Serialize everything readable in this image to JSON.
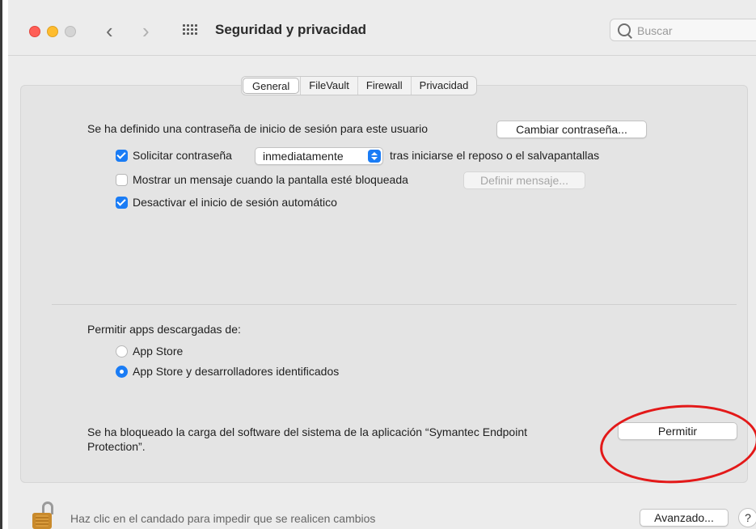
{
  "window": {
    "title": "Seguridad y privacidad",
    "search_placeholder": "Buscar"
  },
  "tabs": [
    {
      "label": "General",
      "selected": true
    },
    {
      "label": "FileVault",
      "selected": false
    },
    {
      "label": "Firewall",
      "selected": false
    },
    {
      "label": "Privacidad",
      "selected": false
    }
  ],
  "general": {
    "password_set_text": "Se ha definido una contraseña de inicio de sesión para este usuario",
    "change_password_button": "Cambiar contraseña...",
    "require_password": {
      "label": "Solicitar contraseña",
      "checked": true
    },
    "require_password_select": "inmediatamente",
    "require_password_suffix": "tras iniciarse el reposo o el salvapantallas",
    "show_message": {
      "label": "Mostrar un mensaje cuando la pantalla esté bloqueada",
      "checked": false
    },
    "set_message_button": "Definir mensaje...",
    "disable_autologin": {
      "label": "Desactivar el inicio de sesión automático",
      "checked": true
    }
  },
  "downloads": {
    "heading": "Permitir apps descargadas de:",
    "options": [
      {
        "label": "App Store",
        "selected": false
      },
      {
        "label": "App Store y desarrolladores identificados",
        "selected": true
      }
    ]
  },
  "blocked": {
    "line1": "Se ha bloqueado la carga del software del sistema de la aplicación “Symantec Endpoint",
    "line2": "Protection”.",
    "allow_button": "Permitir"
  },
  "footer": {
    "lock_text": "Haz clic en el candado para impedir que se realicen cambios",
    "advanced_button": "Avanzado...",
    "help_button": "?"
  },
  "colors": {
    "accent": "#1a7cf5",
    "annotation": "#e31919"
  }
}
